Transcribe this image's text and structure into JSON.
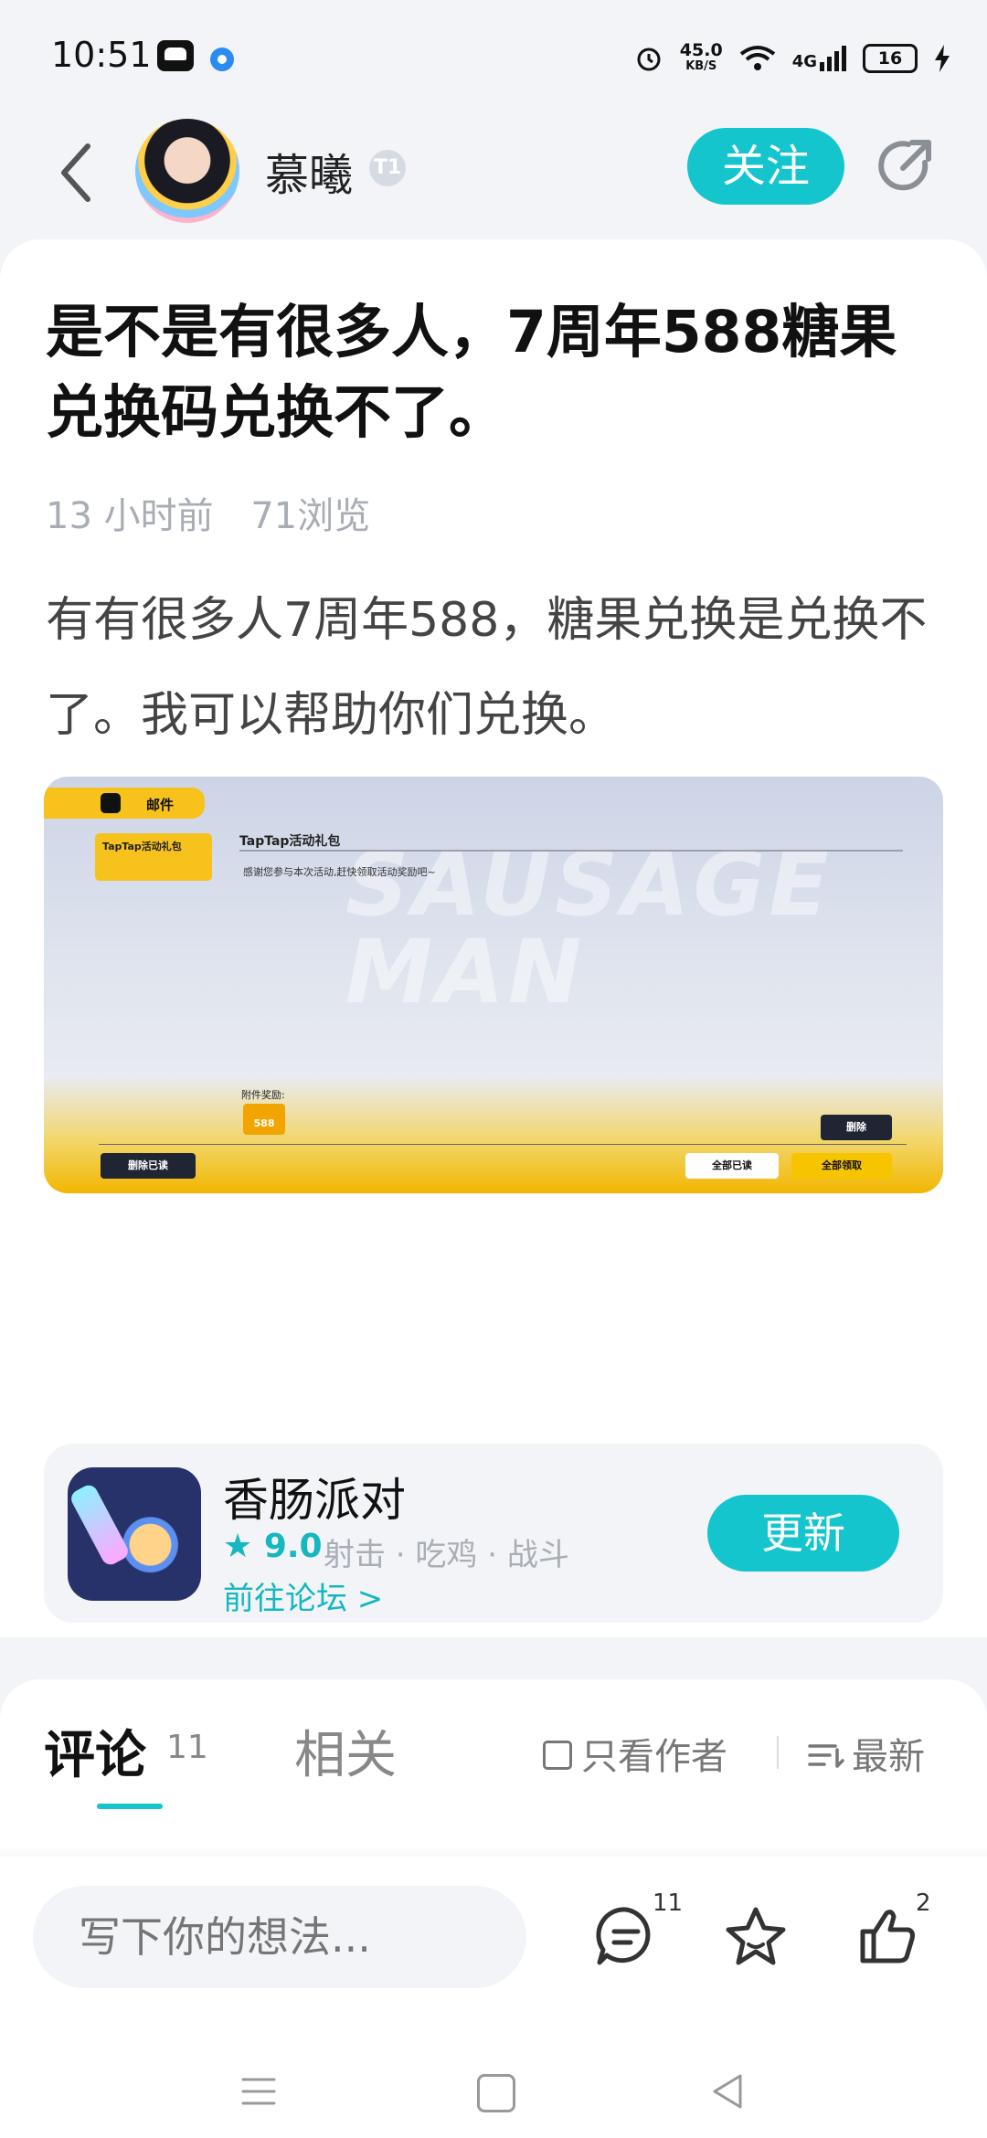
{
  "status_bar": {
    "time": "10:51",
    "net_speed_value": "45.0",
    "net_speed_unit": "KB/S",
    "network": "4G",
    "battery": "16"
  },
  "nav": {
    "author_name": "慕曦",
    "level_badge": "T1",
    "follow_label": "关注"
  },
  "post": {
    "title": "是不是有很多人，7周年588糖果兑换码兑换不了。",
    "time_ago": "13 小时前",
    "views": "71浏览",
    "body": "有有很多人7周年588，糖果兑换是兑换不了。我可以帮助你们兑换。"
  },
  "screenshot": {
    "tab_label": "邮件",
    "item_label": "TapTap活动礼包",
    "mail_title": "TapTap活动礼包",
    "mail_message": "感谢您参与本次活动,赶快领取活动奖励吧~",
    "watermark": "SAUSAGE MAN",
    "attachment_label": "附件奖励:",
    "coin_amount": "588",
    "delete_read_label": "删除已读",
    "delete_label": "删除",
    "read_all_label": "全部已读",
    "claim_all_label": "全部领取"
  },
  "actions": {
    "like_count": "2"
  },
  "game": {
    "name": "香肠派对",
    "rating": "9.0",
    "tags": "射击 · 吃鸡 · 战斗",
    "forum_link": "前往论坛 >",
    "update_label": "更新"
  },
  "comments": {
    "tab_comments": "评论",
    "comments_count": "11",
    "tab_related": "相关",
    "only_author": "只看作者",
    "sort": "最新"
  },
  "bottom_bar": {
    "placeholder": "写下你的想法...",
    "comment_count": "11",
    "like_count": "2"
  },
  "colors": {
    "accent": "#15c5ce",
    "background": "#f2f4f7"
  }
}
